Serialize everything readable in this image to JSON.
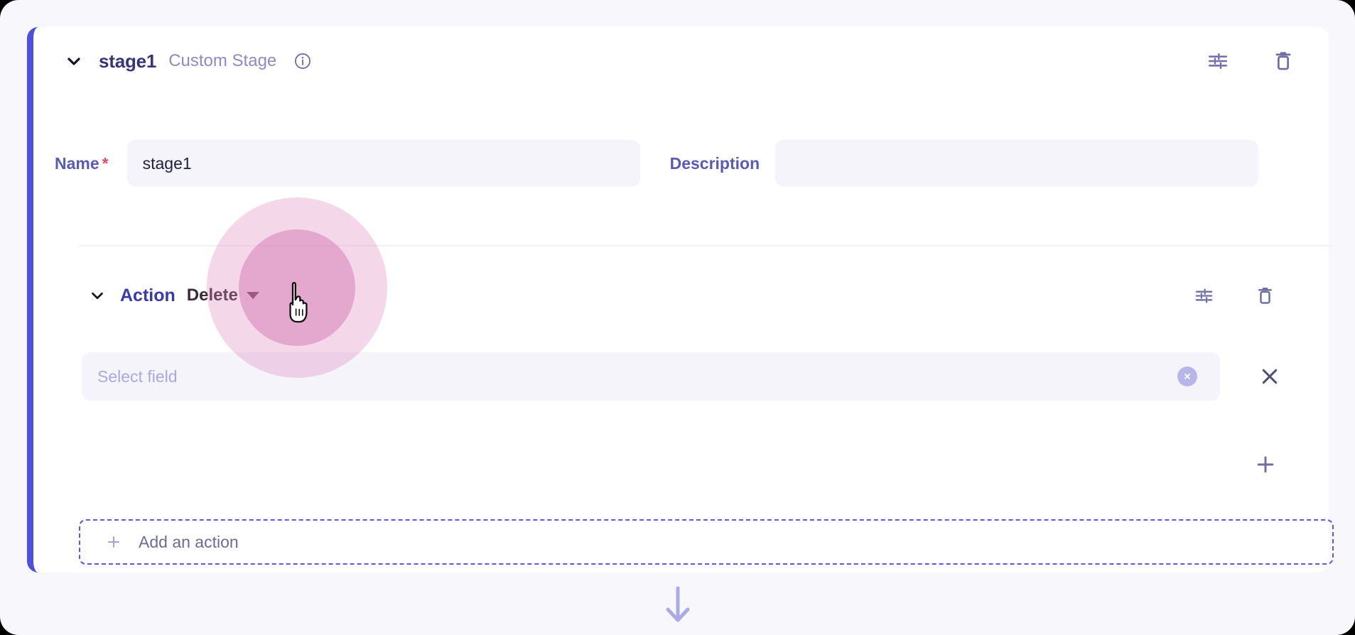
{
  "theme": {
    "background": "#f7f7fc",
    "card_background": "#ffffff",
    "accent_indigo": "#4f4fe0",
    "title_color": "#36357a",
    "muted_purple": "#8c8cc0",
    "field_background": "#f5f4fb",
    "placeholder_color": "#a9a8e0",
    "required_star": "#e4486b",
    "click_highlight": "#d16cae"
  },
  "stage": {
    "collapse_icon": "chevron-down-icon",
    "name": "stage1",
    "type_label": "Custom Stage",
    "info_icon": "info-circle-icon",
    "settings_icon": "sliders-settings-icon",
    "delete_icon": "trash-delete-icon"
  },
  "fields": {
    "name_label": "Name",
    "name_required_mark": "*",
    "name_value": "stage1",
    "name_placeholder": "",
    "description_label": "Description",
    "description_value": "",
    "description_placeholder": ""
  },
  "action": {
    "collapse_icon": "chevron-down-icon",
    "title": "Action",
    "selected_operation": "Delete",
    "dropdown_icon": "caret-down-icon",
    "settings_icon": "sliders-settings-icon",
    "delete_icon": "trash-delete-icon",
    "field_row": {
      "placeholder": "Select field",
      "value": "",
      "clear_icon": "clear-circle-x-icon",
      "remove_icon": "close-x-icon"
    },
    "add_condition_icon": "plus-icon"
  },
  "add_action": {
    "icon": "plus-icon",
    "label": "Add an action"
  },
  "flow": {
    "next_stage_icon": "arrow-down-icon"
  }
}
